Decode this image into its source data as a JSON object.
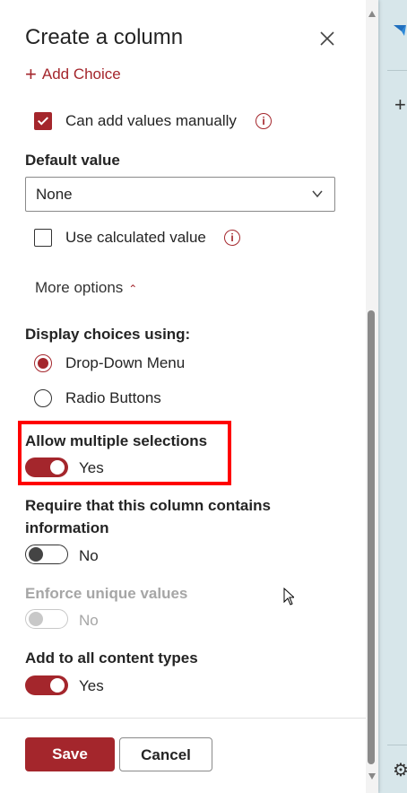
{
  "panel": {
    "title": "Create a column",
    "add_choice": "Add Choice",
    "can_add_values_manually": {
      "label": "Can add values manually",
      "checked": true
    },
    "default_value": {
      "label": "Default value",
      "value": "None"
    },
    "use_calculated_value": {
      "label": "Use calculated value",
      "checked": false
    },
    "more_options": "More options",
    "display_choices": {
      "label": "Display choices using:",
      "options": [
        {
          "label": "Drop-Down Menu",
          "selected": true
        },
        {
          "label": "Radio Buttons",
          "selected": false
        }
      ]
    },
    "allow_multiple": {
      "label": "Allow multiple selections",
      "state": "Yes",
      "on": true
    },
    "require_info": {
      "label_line1": "Require that this column contains",
      "label_line2": "information",
      "state": "No",
      "on": false
    },
    "enforce_unique": {
      "label": "Enforce unique values",
      "state": "No",
      "on": false,
      "disabled": true
    },
    "add_to_content_types": {
      "label": "Add to all content types",
      "state": "Yes",
      "on": true
    }
  },
  "footer": {
    "save": "Save",
    "cancel": "Cancel"
  },
  "colors": {
    "accent": "#a4262c",
    "highlight": "#ff0000"
  },
  "icons": [
    "close-icon",
    "plus-icon",
    "info-icon",
    "chevron-down-icon",
    "caret-up-icon",
    "gear-icon",
    "cursor-icon"
  ]
}
